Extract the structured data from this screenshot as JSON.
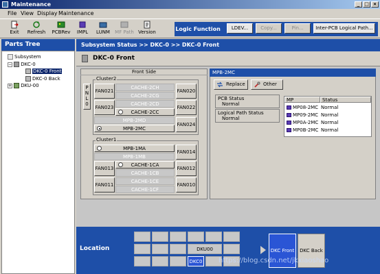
{
  "window": {
    "title": "Maintenance",
    "minimize": "_",
    "maximize": "□",
    "close": "×"
  },
  "menu": [
    "File",
    "View",
    "Display",
    "Maintenance"
  ],
  "toolbar": {
    "buttons": [
      {
        "label": "Exit",
        "icon": "exit-icon",
        "enabled": true
      },
      {
        "label": "Refresh",
        "icon": "refresh-icon",
        "enabled": true
      },
      {
        "label": "PCBRev",
        "icon": "pcbrev-icon",
        "enabled": true
      },
      {
        "label": "IMPL",
        "icon": "impl-icon",
        "enabled": true
      },
      {
        "label": "LUNM",
        "icon": "lunm-icon",
        "enabled": true
      },
      {
        "label": "MF Path",
        "icon": "mf-path-icon",
        "enabled": false
      },
      {
        "label": "Version",
        "icon": "version-icon",
        "enabled": true
      }
    ],
    "logic_function_label": "Logic Function",
    "logic_buttons": [
      {
        "label": "LDEV...",
        "enabled": true
      },
      {
        "label": "Copy...",
        "enabled": false
      },
      {
        "label": "Pin...",
        "enabled": false
      },
      {
        "label": "Inter-PCB Logical Path...",
        "enabled": true
      }
    ]
  },
  "parts_tree": {
    "title": "Parts Tree",
    "nodes": [
      {
        "label": "Subsystem",
        "level": 0,
        "expander": ""
      },
      {
        "label": "DKC-0",
        "level": 1,
        "expander": "−"
      },
      {
        "label": "DKC-0 Front",
        "level": 2,
        "selected": true
      },
      {
        "label": "DKC-0 Back",
        "level": 2
      },
      {
        "label": "DKU-00",
        "level": 1,
        "expander": "+"
      }
    ]
  },
  "breadcrumb": "Subsystem Status >> DKC-0 >> DKC-0 Front",
  "subheader": "DKC-0 Front",
  "front_side": {
    "title": "Front Side",
    "pnl_label": "PNL0",
    "cluster2": {
      "label": "Cluster2",
      "fans_left": [
        "FAN021",
        "FAN023"
      ],
      "fans_right": [
        "FAN020",
        "FAN022",
        "FAN024"
      ],
      "cache": [
        "CACHE-2CH",
        "CACHE-2CG",
        "CACHE-2CD",
        "CACHE-2CC"
      ],
      "mpb": [
        "MPB-2MD",
        "MPB-2MC"
      ]
    },
    "cluster1": {
      "label": "Cluster1",
      "mpb": [
        "MPB-1MA",
        "MPB-1MB"
      ],
      "fans_left": [
        "FAN013",
        "FAN011"
      ],
      "fans_right": [
        "FAN014",
        "FAN012",
        "FAN010"
      ],
      "cache": [
        "CACHE-1CA",
        "CACHE-1CB",
        "CACHE-1CE",
        "CACHE-1CF"
      ]
    }
  },
  "mpb_panel": {
    "title": "MPB-2MC",
    "replace_label": "Replace",
    "other_label": "Other",
    "pcb_status_label": "PCB Status",
    "pcb_status_value": "Normal",
    "logical_path_label": "Logical Path Status",
    "logical_path_value": "Normal",
    "table": {
      "columns": [
        "MP",
        "Status"
      ],
      "rows": [
        {
          "mp": "MP08-2MC",
          "status": "Normal"
        },
        {
          "mp": "MP09-2MC",
          "status": "Normal"
        },
        {
          "mp": "MP0A-2MC",
          "status": "Normal"
        },
        {
          "mp": "MP0B-2MC",
          "status": "Normal"
        }
      ]
    }
  },
  "location": {
    "label": "Location",
    "dku_label": "DKU00",
    "dkc_label": "DKC0",
    "dkc_front": "DKC Front",
    "dkc_back": "DKC Back"
  },
  "watermark": "https://blog.csdn.net/jkxiaoshao",
  "colors": {
    "header_blue": "#1e4fa8",
    "title_gradient_start": "#0a246a",
    "selected_blue": "#2a55d5"
  }
}
